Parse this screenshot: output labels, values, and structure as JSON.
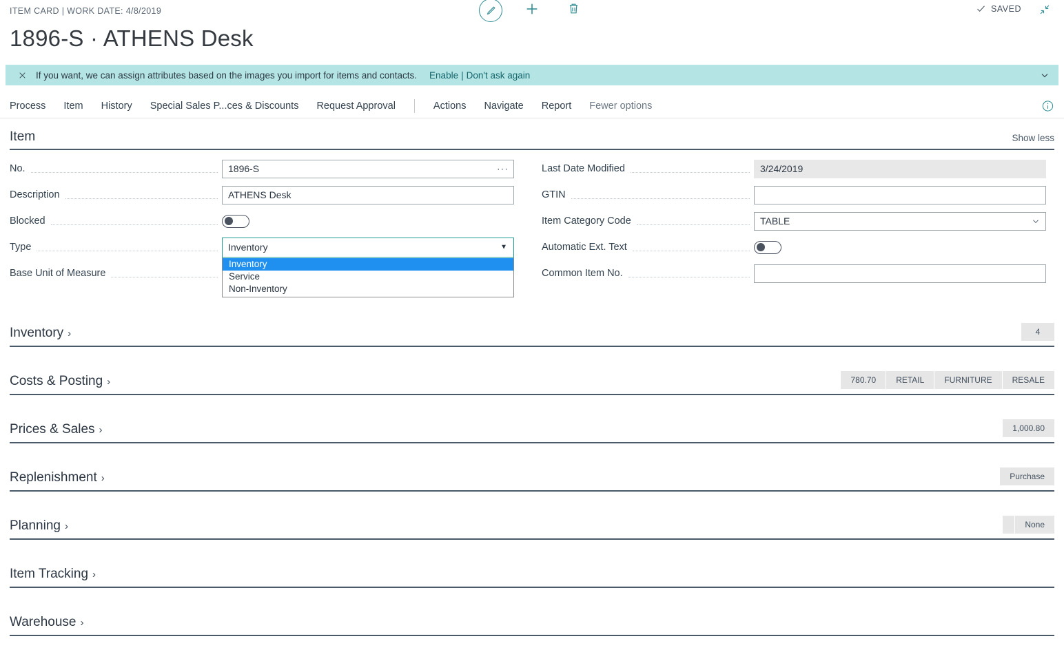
{
  "header": {
    "breadcrumb": "ITEM CARD | WORK DATE: 4/8/2019",
    "title": "1896-S · ATHENS Desk",
    "saved_label": "SAVED",
    "edit_icon": "pencil-icon",
    "new_icon": "plus-icon",
    "delete_icon": "trash-icon",
    "minimize_icon": "collapse-arrows-icon",
    "check_icon": "check-icon"
  },
  "notification": {
    "close_icon": "close-icon",
    "message": "If you want, we can assign attributes based on the images you import for items and contacts.",
    "enable_label": "Enable",
    "separator": "|",
    "dismiss_label": "Don't ask again",
    "chevron_icon": "chevron-down-icon",
    "background": "#B4E5E4"
  },
  "menubar": {
    "items": [
      {
        "label": "Process"
      },
      {
        "label": "Item"
      },
      {
        "label": "History"
      },
      {
        "label": "Special Sales P...ces & Discounts"
      },
      {
        "label": "Request Approval"
      }
    ],
    "items_right": [
      {
        "label": "Actions"
      },
      {
        "label": "Navigate"
      },
      {
        "label": "Report"
      },
      {
        "label": "Fewer options",
        "muted": true
      }
    ],
    "info_icon": "info-circle-icon"
  },
  "item_section": {
    "title": "Item",
    "show_less": "Show less"
  },
  "form": {
    "left": [
      {
        "label": "No.",
        "kind": "text",
        "value": "1896-S",
        "trailing_icon": "ellipsis-icon"
      },
      {
        "label": "Description",
        "kind": "text",
        "value": "ATHENS Desk"
      },
      {
        "label": "Blocked",
        "kind": "toggle",
        "value": "off"
      },
      {
        "label": "Type",
        "kind": "combo-open",
        "value": "Inventory",
        "caret_icon": "caret-down-icon",
        "options": [
          "Inventory",
          "Service",
          "Non-Inventory"
        ],
        "selected_option": "Inventory",
        "focus_color": "#1C9B94",
        "highlight_color": "#1F8FF0"
      },
      {
        "label": "Base Unit of Measure",
        "kind": "hidden-behind-dropdown",
        "value": ""
      }
    ],
    "right": [
      {
        "label": "Last Date Modified",
        "kind": "readonly",
        "value": "3/24/2019"
      },
      {
        "label": "GTIN",
        "kind": "text",
        "value": ""
      },
      {
        "label": "Item Category Code",
        "kind": "select",
        "value": "TABLE",
        "trailing_icon": "chevron-down-icon"
      },
      {
        "label": "Automatic Ext. Text",
        "kind": "toggle",
        "value": "off"
      },
      {
        "label": "Common Item No.",
        "kind": "text",
        "value": ""
      }
    ]
  },
  "sections": [
    {
      "title": "Inventory",
      "chevron": "›",
      "badges": [
        "4"
      ]
    },
    {
      "title": "Costs & Posting",
      "chevron": "›",
      "badges": [
        "780.70",
        "RETAIL",
        "FURNITURE",
        "RESALE"
      ]
    },
    {
      "title": "Prices & Sales",
      "chevron": "›",
      "badges": [
        "1,000.80"
      ]
    },
    {
      "title": "Replenishment",
      "chevron": "›",
      "badges": [
        "Purchase"
      ]
    },
    {
      "title": "Planning",
      "chevron": "›",
      "badges": [
        "",
        "None"
      ]
    },
    {
      "title": "Item Tracking",
      "chevron": "›",
      "badges": []
    },
    {
      "title": "Warehouse",
      "chevron": "›",
      "badges": []
    }
  ]
}
